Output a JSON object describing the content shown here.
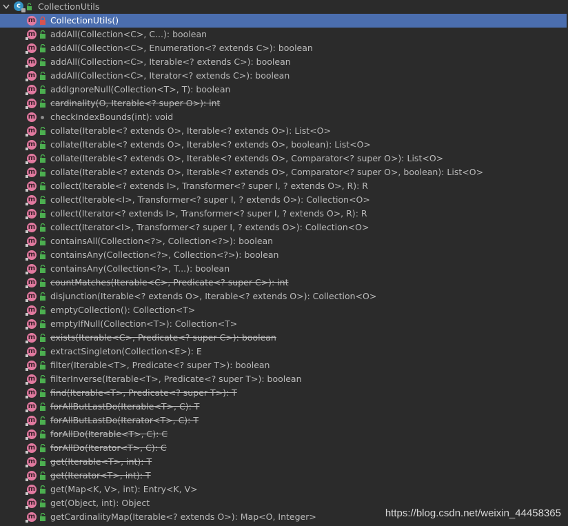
{
  "root": {
    "label": "CollectionUtils",
    "icon": "class-icon"
  },
  "members": [
    {
      "label": "CollectionUtils()",
      "vis": "private",
      "deprecated": false,
      "selected": true
    },
    {
      "label": "addAll(Collection<C>, C...): boolean",
      "vis": "public",
      "deprecated": false
    },
    {
      "label": "addAll(Collection<C>, Enumeration<? extends C>): boolean",
      "vis": "public",
      "deprecated": false
    },
    {
      "label": "addAll(Collection<C>, Iterable<? extends C>): boolean",
      "vis": "public",
      "deprecated": false
    },
    {
      "label": "addAll(Collection<C>, Iterator<? extends C>): boolean",
      "vis": "public",
      "deprecated": false
    },
    {
      "label": "addIgnoreNull(Collection<T>, T): boolean",
      "vis": "public",
      "deprecated": false
    },
    {
      "label": "cardinality(O, Iterable<? super O>): int",
      "vis": "public",
      "deprecated": true
    },
    {
      "label": "checkIndexBounds(int): void",
      "vis": "package",
      "deprecated": false
    },
    {
      "label": "collate(Iterable<? extends O>, Iterable<? extends O>): List<O>",
      "vis": "public",
      "deprecated": false
    },
    {
      "label": "collate(Iterable<? extends O>, Iterable<? extends O>, boolean): List<O>",
      "vis": "public",
      "deprecated": false
    },
    {
      "label": "collate(Iterable<? extends O>, Iterable<? extends O>, Comparator<? super O>): List<O>",
      "vis": "public",
      "deprecated": false
    },
    {
      "label": "collate(Iterable<? extends O>, Iterable<? extends O>, Comparator<? super O>, boolean): List<O>",
      "vis": "public",
      "deprecated": false
    },
    {
      "label": "collect(Iterable<? extends I>, Transformer<? super I, ? extends O>, R): R",
      "vis": "public",
      "deprecated": false
    },
    {
      "label": "collect(Iterable<I>, Transformer<? super I, ? extends O>): Collection<O>",
      "vis": "public",
      "deprecated": false
    },
    {
      "label": "collect(Iterator<? extends I>, Transformer<? super I, ? extends O>, R): R",
      "vis": "public",
      "deprecated": false
    },
    {
      "label": "collect(Iterator<I>, Transformer<? super I, ? extends O>): Collection<O>",
      "vis": "public",
      "deprecated": false
    },
    {
      "label": "containsAll(Collection<?>, Collection<?>): boolean",
      "vis": "public",
      "deprecated": false
    },
    {
      "label": "containsAny(Collection<?>, Collection<?>): boolean",
      "vis": "public",
      "deprecated": false
    },
    {
      "label": "containsAny(Collection<?>, T...): boolean",
      "vis": "public",
      "deprecated": false
    },
    {
      "label": "countMatches(Iterable<C>, Predicate<? super C>): int",
      "vis": "public",
      "deprecated": true
    },
    {
      "label": "disjunction(Iterable<? extends O>, Iterable<? extends O>): Collection<O>",
      "vis": "public",
      "deprecated": false
    },
    {
      "label": "emptyCollection(): Collection<T>",
      "vis": "public",
      "deprecated": false
    },
    {
      "label": "emptyIfNull(Collection<T>): Collection<T>",
      "vis": "public",
      "deprecated": false
    },
    {
      "label": "exists(Iterable<C>, Predicate<? super C>): boolean",
      "vis": "public",
      "deprecated": true
    },
    {
      "label": "extractSingleton(Collection<E>): E",
      "vis": "public",
      "deprecated": false
    },
    {
      "label": "filter(Iterable<T>, Predicate<? super T>): boolean",
      "vis": "public",
      "deprecated": false
    },
    {
      "label": "filterInverse(Iterable<T>, Predicate<? super T>): boolean",
      "vis": "public",
      "deprecated": false
    },
    {
      "label": "find(Iterable<T>, Predicate<? super T>): T",
      "vis": "public",
      "deprecated": true
    },
    {
      "label": "forAllButLastDo(Iterable<T>, C): T",
      "vis": "public",
      "deprecated": true
    },
    {
      "label": "forAllButLastDo(Iterator<T>, C): T",
      "vis": "public",
      "deprecated": true
    },
    {
      "label": "forAllDo(Iterable<T>, C): C",
      "vis": "public",
      "deprecated": true
    },
    {
      "label": "forAllDo(Iterator<T>, C): C",
      "vis": "public",
      "deprecated": true
    },
    {
      "label": "get(Iterable<T>, int): T",
      "vis": "public",
      "deprecated": true
    },
    {
      "label": "get(Iterator<T>, int): T",
      "vis": "public",
      "deprecated": true
    },
    {
      "label": "get(Map<K, V>, int): Entry<K, V>",
      "vis": "public",
      "deprecated": false
    },
    {
      "label": "get(Object, int): Object",
      "vis": "public",
      "deprecated": false
    },
    {
      "label": "getCardinalityMap(Iterable<? extends O>): Map<O, Integer>",
      "vis": "public",
      "deprecated": false
    }
  ],
  "watermark": "https://blog.csdn.net/weixin_44458365",
  "colors": {
    "background": "#2b2b2b",
    "selection": "#4b6eaf",
    "method_icon": "#e27aa0",
    "class_icon": "#3592c4",
    "public_lock": "#4caf50",
    "private_lock": "#d9534f"
  }
}
